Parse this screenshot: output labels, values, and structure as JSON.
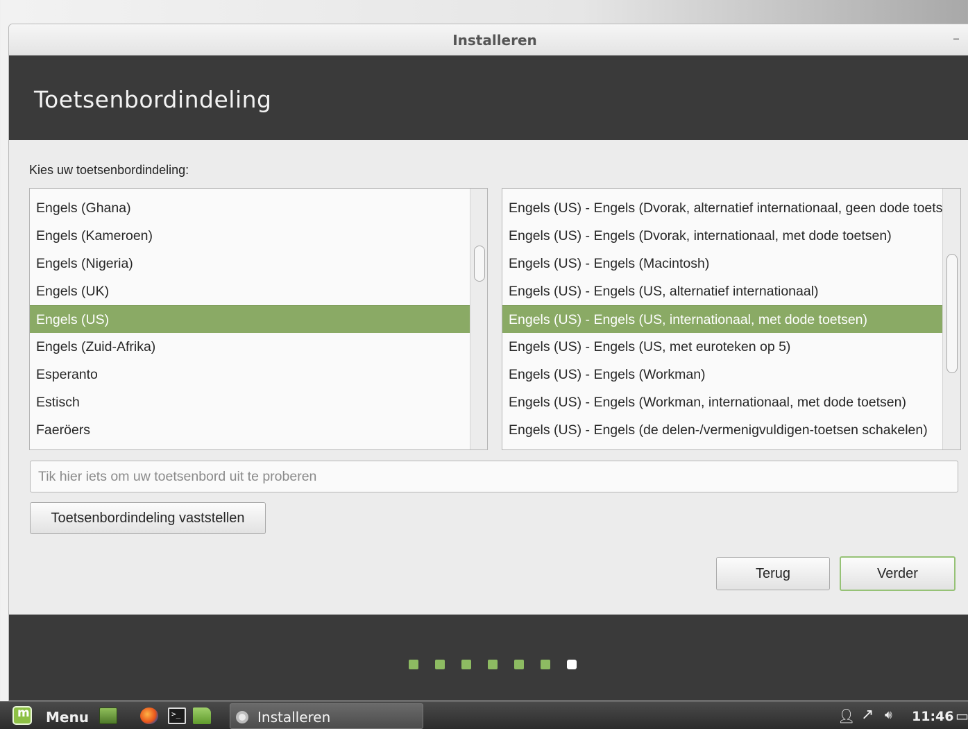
{
  "window": {
    "title": "Installeren",
    "minimize_glyph": "–"
  },
  "header": {
    "title": "Toetsenbordindeling"
  },
  "content": {
    "prompt": "Kies uw toetsenbordindeling:",
    "layouts": [
      "Engels (Ghana)",
      "Engels (Kameroen)",
      "Engels (Nigeria)",
      "Engels (UK)",
      "Engels (US)",
      "Engels (Zuid-Afrika)",
      "Esperanto",
      "Estisch",
      "Faeröers"
    ],
    "selected_layout": "Engels (US)",
    "variants": [
      "Engels (US) - Engels (Dvorak, alternatief internationaal, geen dode toetsen)",
      "Engels (US) - Engels (Dvorak, internationaal, met dode toetsen)",
      "Engels (US) - Engels (Macintosh)",
      "Engels (US) - Engels (US, alternatief internationaal)",
      "Engels (US) - Engels (US, internationaal, met dode toetsen)",
      "Engels (US) - Engels (US, met euroteken op 5)",
      "Engels (US) - Engels (Workman)",
      "Engels (US) - Engels (Workman, internationaal, met dode toetsen)",
      "Engels (US) - Engels (de delen-/vermenigvuldigen-toetsen schakelen)"
    ],
    "selected_variant": "Engels (US) - Engels (US, internationaal, met dode toetsen)",
    "test_field": {
      "placeholder": "Tik hier iets om uw toetsenbord uit te proberen",
      "value": ""
    },
    "detect_button": "Toetsenbordindeling vaststellen",
    "back_button": "Terug",
    "next_button": "Verder"
  },
  "progress": {
    "total_steps": 7,
    "current_step": 7
  },
  "colors": {
    "selection": "#8aaa65",
    "accent": "#8dbb62",
    "header_bg": "#3a3a3a"
  },
  "taskbar": {
    "menu_label": "Menu",
    "launchers": [
      "desktop-icon",
      "firefox-icon",
      "terminal-icon",
      "files-icon"
    ],
    "task_label": "Installeren",
    "clock": "11:46",
    "tray_icons": [
      "user-icon",
      "network-icon",
      "volume-icon",
      "display-icon"
    ]
  }
}
